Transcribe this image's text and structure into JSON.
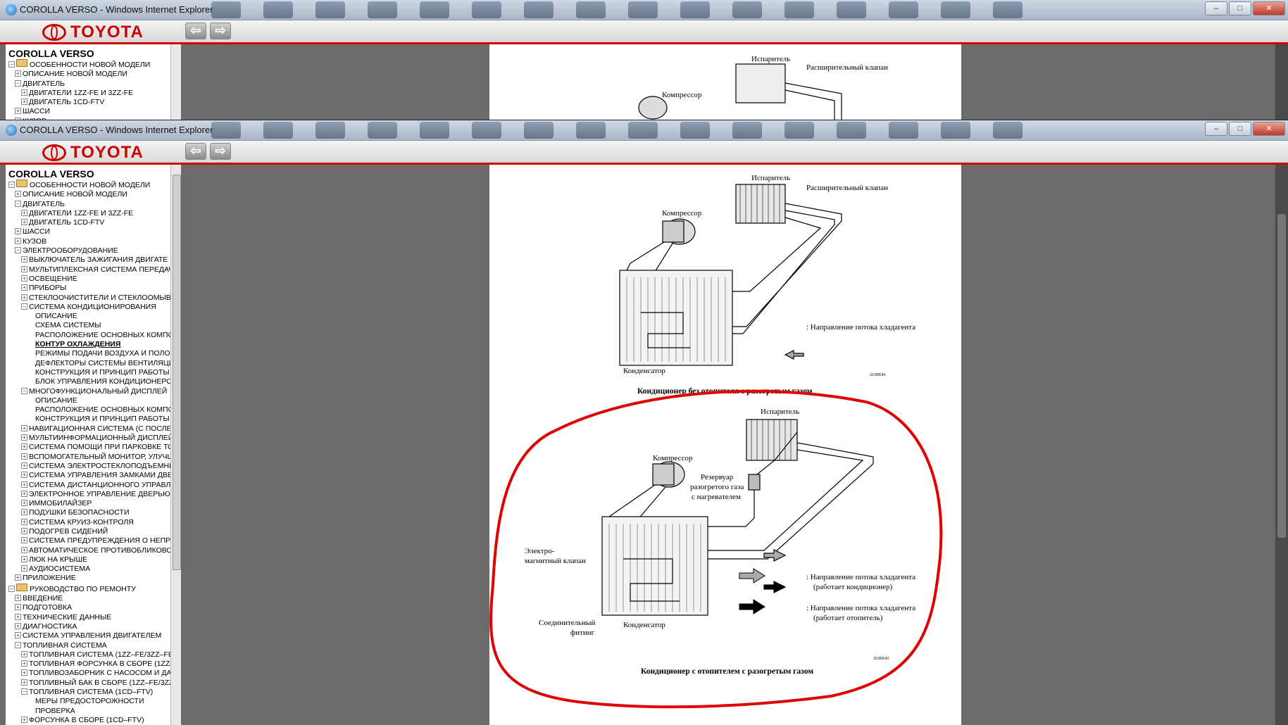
{
  "window": {
    "title": "COROLLA VERSO - Windows Internet Explorer",
    "controls": {
      "minimize": "–",
      "maximize": "□",
      "close": "✕"
    }
  },
  "toolbar": {
    "logo_text": "TOYOTA",
    "back": "⇦",
    "forward": "⇨"
  },
  "sidebar": {
    "title": "COROLLA VERSO",
    "items": [
      {
        "pm": "−",
        "label": "ОСОБЕННОСТИ НОВОЙ МОДЕЛИ",
        "level": 0,
        "book": true
      },
      {
        "pm": "+",
        "label": "ОПИСАНИЕ НОВОЙ МОДЕЛИ",
        "level": 1
      },
      {
        "pm": "−",
        "label": "ДВИГАТЕЛЬ",
        "level": 1
      },
      {
        "pm": "+",
        "label": "ДВИГАТЕЛИ 1ZZ-FE И 3ZZ-FE",
        "level": 2
      },
      {
        "pm": "+",
        "label": "ДВИГАТЕЛЬ 1CD-FTV",
        "level": 2
      },
      {
        "pm": "+",
        "label": "ШАССИ",
        "level": 1
      },
      {
        "pm": "+",
        "label": "КУЗОВ",
        "level": 1
      },
      {
        "pm": "−",
        "label": "ЭЛЕКТРООБОРУДОВАНИЕ",
        "level": 1
      },
      {
        "pm": "+",
        "label": "ВЫКЛЮЧАТЕЛЬ ЗАЖИГАНИЯ ДВИГАТЕ",
        "level": 2
      },
      {
        "pm": "+",
        "label": "МУЛЬТИПЛЕКСНАЯ СИСТЕМА ПЕРЕДАЧ",
        "level": 2
      },
      {
        "pm": "+",
        "label": "ОСВЕЩЕНИЕ",
        "level": 2
      },
      {
        "pm": "+",
        "label": "ПРИБОРЫ",
        "level": 2
      },
      {
        "pm": "+",
        "label": "СТЕКЛООЧИСТИТЕЛИ И СТЕКЛООМЫВА",
        "level": 2
      },
      {
        "pm": "−",
        "label": "СИСТЕМА КОНДИЦИОНИРОВАНИЯ",
        "level": 2
      },
      {
        "pm": "",
        "label": "ОПИСАНИЕ",
        "level": 3
      },
      {
        "pm": "",
        "label": "СХЕМА СИСТЕМЫ",
        "level": 3
      },
      {
        "pm": "",
        "label": "РАСПОЛОЖЕНИЕ ОСНОВНЫХ КОМПОН",
        "level": 3
      },
      {
        "pm": "",
        "label": "КОНТУР ОХЛАЖДЕНИЯ",
        "level": 3,
        "selected": true
      },
      {
        "pm": "",
        "label": "РЕЖИМЫ ПОДАЧИ ВОЗДУХА И ПОЛО",
        "level": 3
      },
      {
        "pm": "",
        "label": "ДЕФЛЕКТОРЫ СИСТЕМЫ ВЕНТИЛЯЦИИ",
        "level": 3
      },
      {
        "pm": "",
        "label": "КОНСТРУКЦИЯ И ПРИНЦИП РАБОТЫ",
        "level": 3
      },
      {
        "pm": "",
        "label": "БЛОК УПРАВЛЕНИЯ КОНДИЦИОНЕРОМ",
        "level": 3
      },
      {
        "pm": "−",
        "label": "МНОГОФУНКЦИОНАЛЬНЫЙ ДИСПЛЕЙ",
        "level": 2
      },
      {
        "pm": "",
        "label": "ОПИСАНИЕ",
        "level": 3
      },
      {
        "pm": "",
        "label": "РАСПОЛОЖЕНИЕ ОСНОВНЫХ КОМПОН",
        "level": 3
      },
      {
        "pm": "",
        "label": "КОНСТРУКЦИЯ И ПРИНЦИП РАБОТЫ",
        "level": 3
      },
      {
        "pm": "+",
        "label": "НАВИГАЦИОННАЯ СИСТЕМА (С ПОСЛЕ",
        "level": 2
      },
      {
        "pm": "+",
        "label": "МУЛЬТИИНФОРМАЦИОННЫЙ ДИСПЛЕЙ",
        "level": 2
      },
      {
        "pm": "+",
        "label": "СИСТЕМА ПОМОЩИ ПРИ ПАРКОВКЕ ТО",
        "level": 2
      },
      {
        "pm": "+",
        "label": "ВСПОМОГАТЕЛЬНЫЙ МОНИТОР, УЛУЧШ",
        "level": 2
      },
      {
        "pm": "+",
        "label": "СИСТЕМА ЭЛЕКТРОСТЕКЛОПОДЪЕМНИ",
        "level": 2
      },
      {
        "pm": "+",
        "label": "СИСТЕМА УПРАВЛЕНИЯ ЗАМКАМИ ДВЕ",
        "level": 2
      },
      {
        "pm": "+",
        "label": "СИСТЕМА ДИСТАНЦИОННОГО УПРАВЛЕ",
        "level": 2
      },
      {
        "pm": "+",
        "label": "ЭЛЕКТРОННОЕ УПРАВЛЕНИЕ ДВЕРЬЮ Б",
        "level": 2
      },
      {
        "pm": "+",
        "label": "ИММОБИЛАЙЗЕР",
        "level": 2
      },
      {
        "pm": "+",
        "label": "ПОДУШКИ БЕЗОПАСНОСТИ",
        "level": 2
      },
      {
        "pm": "+",
        "label": "СИСТЕМА КРУИЗ-КОНТРОЛЯ",
        "level": 2
      },
      {
        "pm": "+",
        "label": "ПОДОГРЕВ СИДЕНИЙ",
        "level": 2
      },
      {
        "pm": "+",
        "label": "СИСТЕМА ПРЕДУПРЕЖДЕНИЯ О НЕПРИ",
        "level": 2
      },
      {
        "pm": "+",
        "label": "АВТОМАТИЧЕСКОЕ ПРОТИВОБЛИКОВО",
        "level": 2
      },
      {
        "pm": "+",
        "label": "ЛЮК НА КРЫШЕ",
        "level": 2
      },
      {
        "pm": "+",
        "label": "АУДИОСИСТЕМА",
        "level": 2
      },
      {
        "pm": "+",
        "label": "ПРИЛОЖЕНИЕ",
        "level": 1
      },
      {
        "pm": "−",
        "label": "РУКОВОДСТВО ПО РЕМОНТУ",
        "level": 0,
        "book": true
      },
      {
        "pm": "+",
        "label": "ВВЕДЕНИЕ",
        "level": 1
      },
      {
        "pm": "+",
        "label": "ПОДГОТОВКА",
        "level": 1
      },
      {
        "pm": "+",
        "label": "ТЕХНИЧЕСКИЕ ДАННЫЕ",
        "level": 1
      },
      {
        "pm": "+",
        "label": "ДИАГНОСТИКА",
        "level": 1
      },
      {
        "pm": "+",
        "label": "СИСТЕМА УПРАВЛЕНИЯ ДВИГАТЕЛЕМ",
        "level": 1
      },
      {
        "pm": "−",
        "label": "ТОПЛИВНАЯ СИСТЕМА",
        "level": 1
      },
      {
        "pm": "+",
        "label": "ТОПЛИВНАЯ СИСТЕМА (1ZZ–FE/3ZZ–FE",
        "level": 2
      },
      {
        "pm": "+",
        "label": "ТОПЛИВНАЯ ФОРСУНКА В СБОРЕ (1ZZ–",
        "level": 2
      },
      {
        "pm": "+",
        "label": "ТОПЛИВОЗАБОРНИК С НАСОСОМ И ДА",
        "level": 2
      },
      {
        "pm": "+",
        "label": "ТОПЛИВНЫЙ БАК В СБОРЕ (1ZZ–FE/3ZZ",
        "level": 2
      },
      {
        "pm": "−",
        "label": "ТОПЛИВНАЯ СИСТЕМА (1CD–FTV)",
        "level": 2
      },
      {
        "pm": "",
        "label": "МЕРЫ ПРЕДОСТОРОЖНОСТИ",
        "level": 3
      },
      {
        "pm": "",
        "label": "ПРОВЕРКА",
        "level": 3
      },
      {
        "pm": "+",
        "label": "ФОРСУНКА В СБОРЕ (1CD–FTV)",
        "level": 2
      }
    ]
  },
  "diagram1": {
    "evaporator": "Испаритель",
    "expansion_valve": "Расширительный клапан",
    "compressor": "Компрессор",
    "condenser": "Конденсатор",
    "legend": ": Направление потока хладагента",
    "code": "263BE46",
    "caption": "Кондиционер без отопителя с разогретым газом"
  },
  "diagram2": {
    "evaporator": "Испаритель",
    "compressor": "Компрессор",
    "reservoir_1": "Резервуар",
    "reservoir_2": "разогретого газа",
    "reservoir_3": "с нагревателем",
    "valve_1": "Электро-",
    "valve_2": "магнитный клапан",
    "fitting_1": "Соединительный",
    "fitting_2": "фитинг",
    "condenser": "Конденсатор",
    "legend_ac_1": ":  Направление потока хладагента",
    "legend_ac_2": "(работает кондиционер)",
    "legend_heat_1": ":  Направление потока хладагента",
    "legend_heat_2": "(работает отопитель)",
    "code": "263BE45",
    "caption": "Кондиционер с отопителем с разогретым газом"
  },
  "colors": {
    "brand": "#cc0000",
    "annotation": "#e00000"
  }
}
